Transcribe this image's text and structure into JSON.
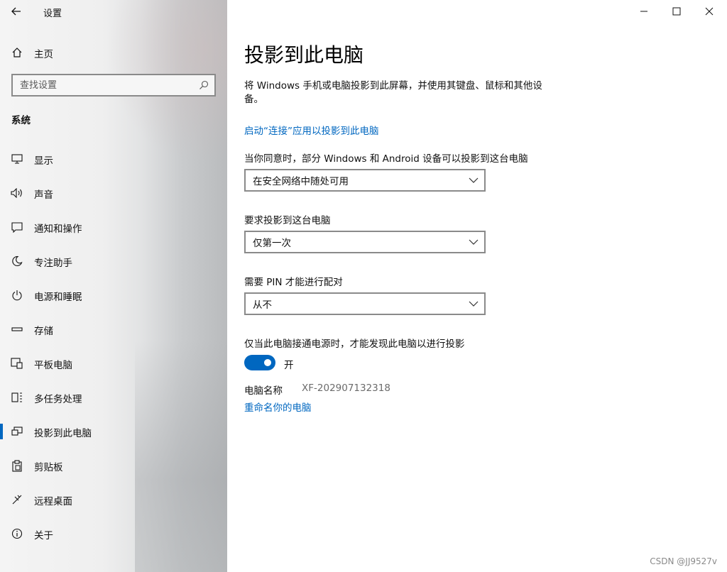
{
  "window": {
    "title": "设置",
    "controls": {
      "minimize": "minimize",
      "maximize": "maximize",
      "close": "close"
    }
  },
  "sidebar": {
    "home_label": "主页",
    "search_placeholder": "查找设置",
    "section_title": "系统",
    "items": [
      {
        "label": "显示",
        "icon": "monitor-icon"
      },
      {
        "label": "声音",
        "icon": "speaker-icon"
      },
      {
        "label": "通知和操作",
        "icon": "notification-icon"
      },
      {
        "label": "专注助手",
        "icon": "moon-icon"
      },
      {
        "label": "电源和睡眠",
        "icon": "power-icon"
      },
      {
        "label": "存储",
        "icon": "storage-icon"
      },
      {
        "label": "平板电脑",
        "icon": "tablet-icon"
      },
      {
        "label": "多任务处理",
        "icon": "multitask-icon"
      },
      {
        "label": "投影到此电脑",
        "icon": "project-icon",
        "active": true
      },
      {
        "label": "剪贴板",
        "icon": "clipboard-icon"
      },
      {
        "label": "远程桌面",
        "icon": "remote-desktop-icon"
      },
      {
        "label": "关于",
        "icon": "info-icon"
      }
    ]
  },
  "main": {
    "title": "投影到此电脑",
    "description": "将 Windows 手机或电脑投影到此屏幕，并使用其键盘、鼠标和其他设备。",
    "connect_link": "启动“连接”应用以投影到此电脑",
    "availability": {
      "label": "当你同意时，部分 Windows 和 Android 设备可以投影到这台电脑",
      "value": "在安全网络中随处可用"
    },
    "ask_to_project": {
      "label": "要求投影到这台电脑",
      "value": "仅第一次"
    },
    "pin": {
      "label": "需要 PIN 才能进行配对",
      "value": "从不"
    },
    "power_discovery": {
      "label": "仅当此电脑接通电源时，才能发现此电脑以进行投影",
      "state": "开",
      "on": true
    },
    "pc_name": {
      "label": "电脑名称",
      "value": "XF-202907132318"
    },
    "rename_link": "重命名你的电脑"
  },
  "watermark": "CSDN @JJ9527v",
  "colors": {
    "accent": "#0067c0"
  }
}
